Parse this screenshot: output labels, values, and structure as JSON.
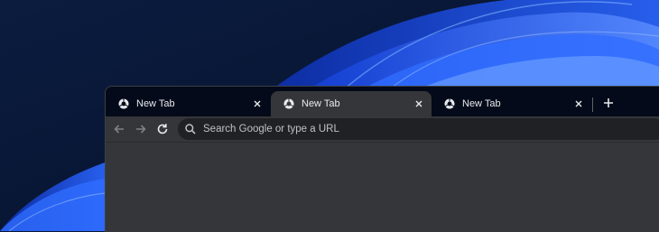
{
  "wallpaper": {
    "accent": "#1b4fe0",
    "background": "#0a1836"
  },
  "tabs": [
    {
      "title": "New Tab",
      "active": false,
      "favicon": "chrome-icon"
    },
    {
      "title": "New Tab",
      "active": true,
      "favicon": "chrome-icon"
    },
    {
      "title": "New Tab",
      "active": false,
      "favicon": "chrome-icon"
    }
  ],
  "toolbar": {
    "back_icon": "arrow-left-icon",
    "forward_icon": "arrow-right-icon",
    "reload_icon": "reload-icon",
    "new_tab_icon": "plus-icon"
  },
  "omnibox": {
    "placeholder": "Search Google or type a URL",
    "value": ""
  },
  "colors": {
    "tabstrip": "#050a1a",
    "active_tab": "#35363a",
    "omnibox": "#202124"
  }
}
